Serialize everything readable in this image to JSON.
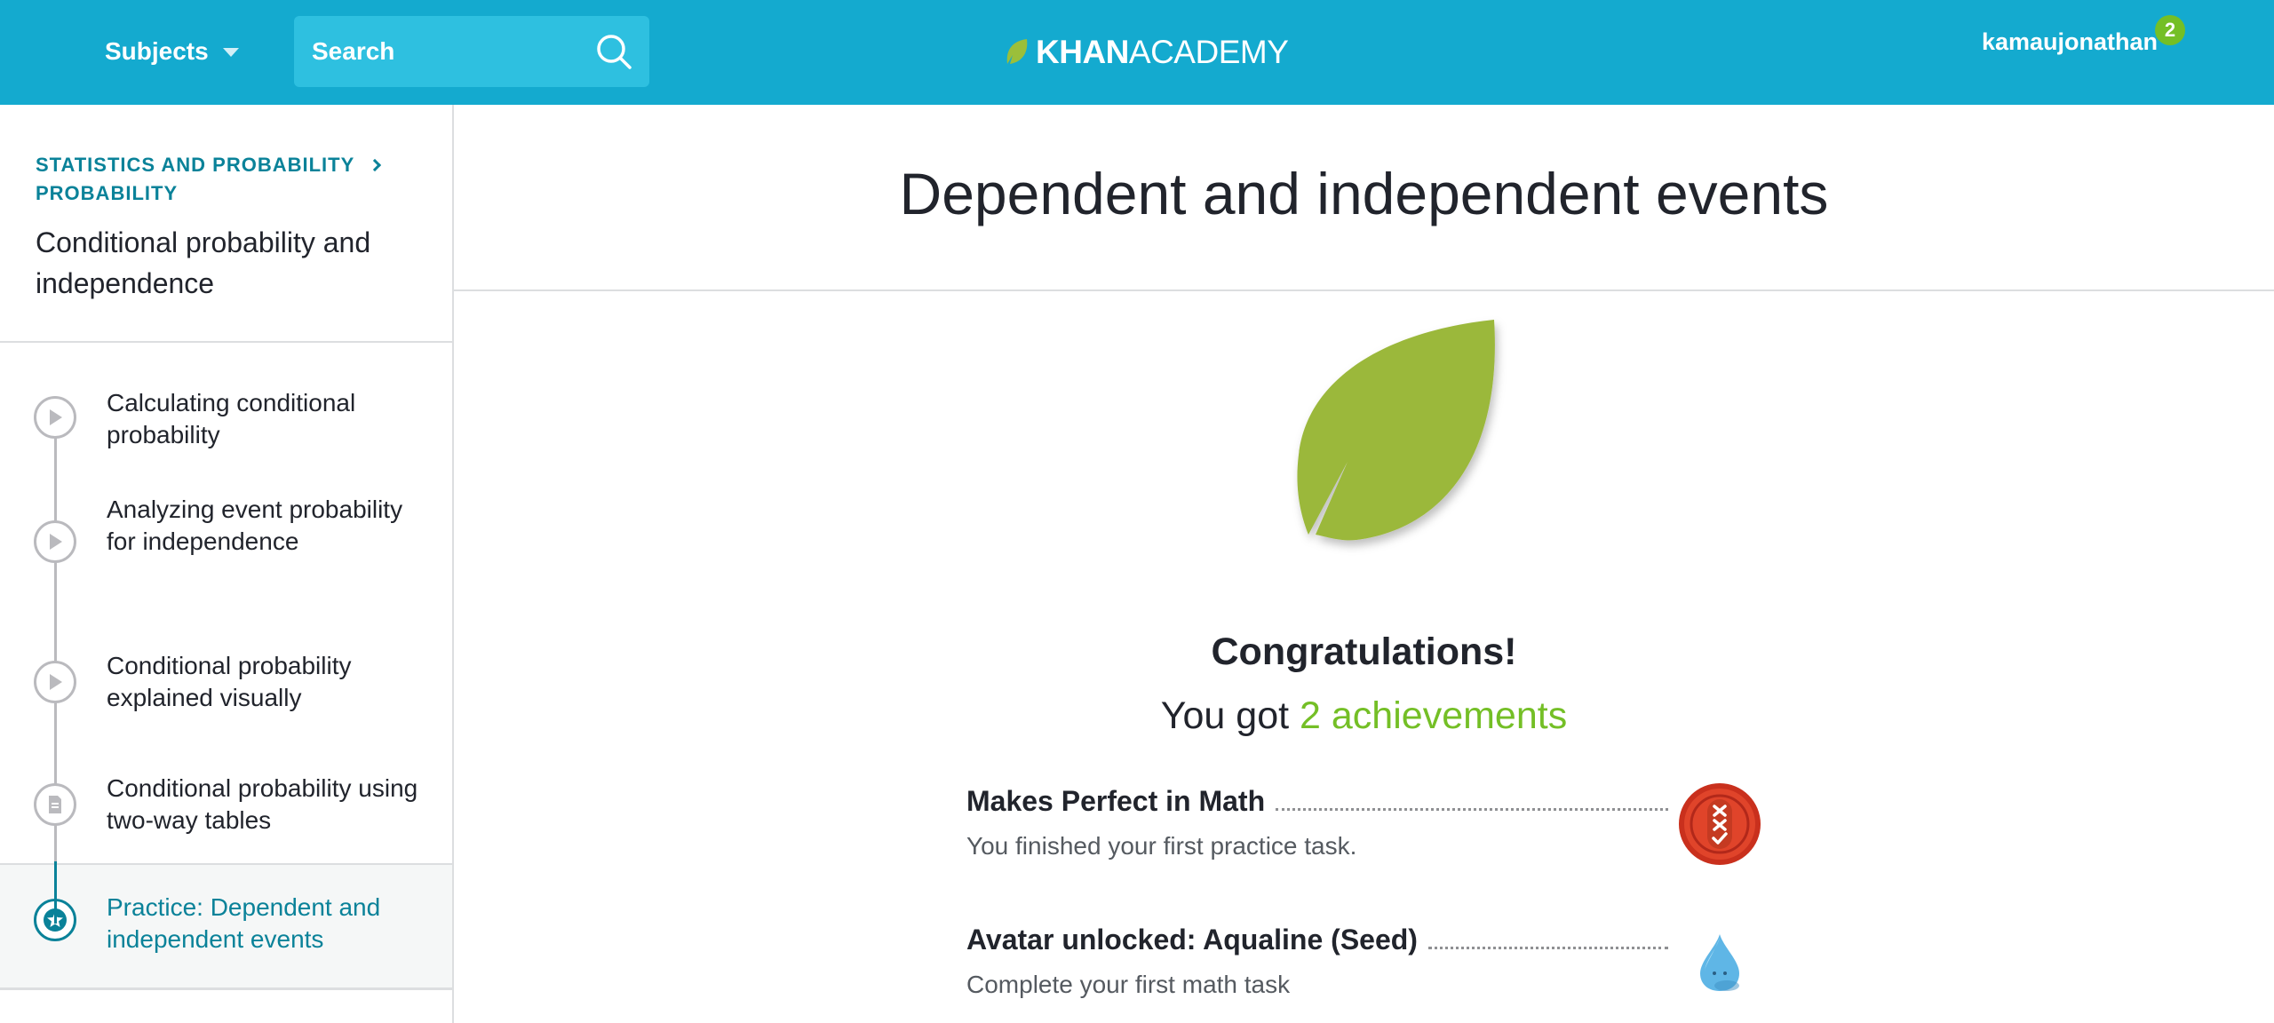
{
  "header": {
    "subjects_label": "Subjects",
    "search_placeholder": "Search",
    "logo_bold": "KHAN",
    "logo_light": "ACADEMY",
    "username": "kamaujonathan",
    "notification_count": "2",
    "brand_color": "#14aacf"
  },
  "sidebar": {
    "breadcrumb": [
      "STATISTICS AND PROBABILITY",
      "PROBABILITY"
    ],
    "unit_title": "Conditional probability and independence",
    "items": [
      {
        "label": "Calculating conditional probability",
        "icon": "play-icon"
      },
      {
        "label": "Analyzing event probability for independence",
        "icon": "play-icon"
      },
      {
        "label": "Conditional probability explained visually",
        "icon": "play-icon"
      },
      {
        "label": "Conditional probability using two-way tables",
        "icon": "article-icon"
      },
      {
        "label": "Practice: Dependent and independent events",
        "icon": "star-icon",
        "active": true
      }
    ]
  },
  "main": {
    "title": "Dependent and independent events",
    "congrats": "Congratulations!",
    "got_prefix": "You got",
    "got_accent": "2 achievements",
    "accent_color": "#74bf26",
    "achievements": [
      {
        "name": "Makes Perfect in Math",
        "description": "You finished your first practice task.",
        "badge": "practice-badge-icon"
      },
      {
        "name": "Avatar unlocked: Aqualine (Seed)",
        "description": "Complete your first math task",
        "badge": "water-drop-avatar-icon"
      }
    ]
  }
}
